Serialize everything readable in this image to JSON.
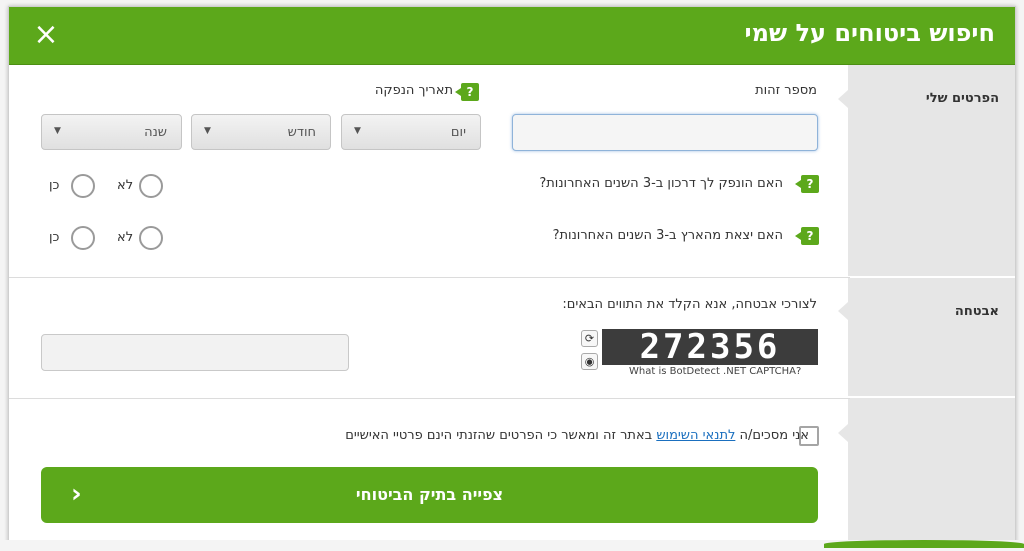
{
  "header": {
    "title": "חיפוש ביטוחים על שמי",
    "close_label": "×"
  },
  "sidebar": {
    "sections": [
      {
        "label": "הפרטים שלי"
      },
      {
        "label": "אבטחה"
      },
      {
        "label": ""
      }
    ]
  },
  "details": {
    "id_label": "מספר זהות",
    "id_value": "",
    "issue_date_label": "תאריך הנפקה",
    "help_glyph": "?",
    "day_label": "יום",
    "month_label": "חודש",
    "year_label": "שנה",
    "q_passport": "האם הונפק לך דרכון ב-3 השנים האחרונות?",
    "q_abroad": "האם יצאת מהארץ ב-3 השנים האחרונות?",
    "no_label": "לא",
    "yes_label": "כן"
  },
  "security": {
    "prompt": "לצורכי אבטחה, אנא הקלד את התווים הבאים:",
    "captcha_text": "272356",
    "captcha_sub": "What is BotDetect .NET CAPTCHA?",
    "code_value": ""
  },
  "terms": {
    "agree_prefix": "אני מסכים/ה",
    "terms_link": "לתנאי השימוש",
    "agree_suffix": "באתר זה ומאשר כי הפרטים שהזנתי הינם פרטיי האישיים"
  },
  "submit": {
    "label": "צפייה בתיק הביטוחי",
    "chevron": "‹"
  },
  "colors": {
    "brand_green": "#5ca81b",
    "sidebar_gray": "#e6e6e6"
  }
}
